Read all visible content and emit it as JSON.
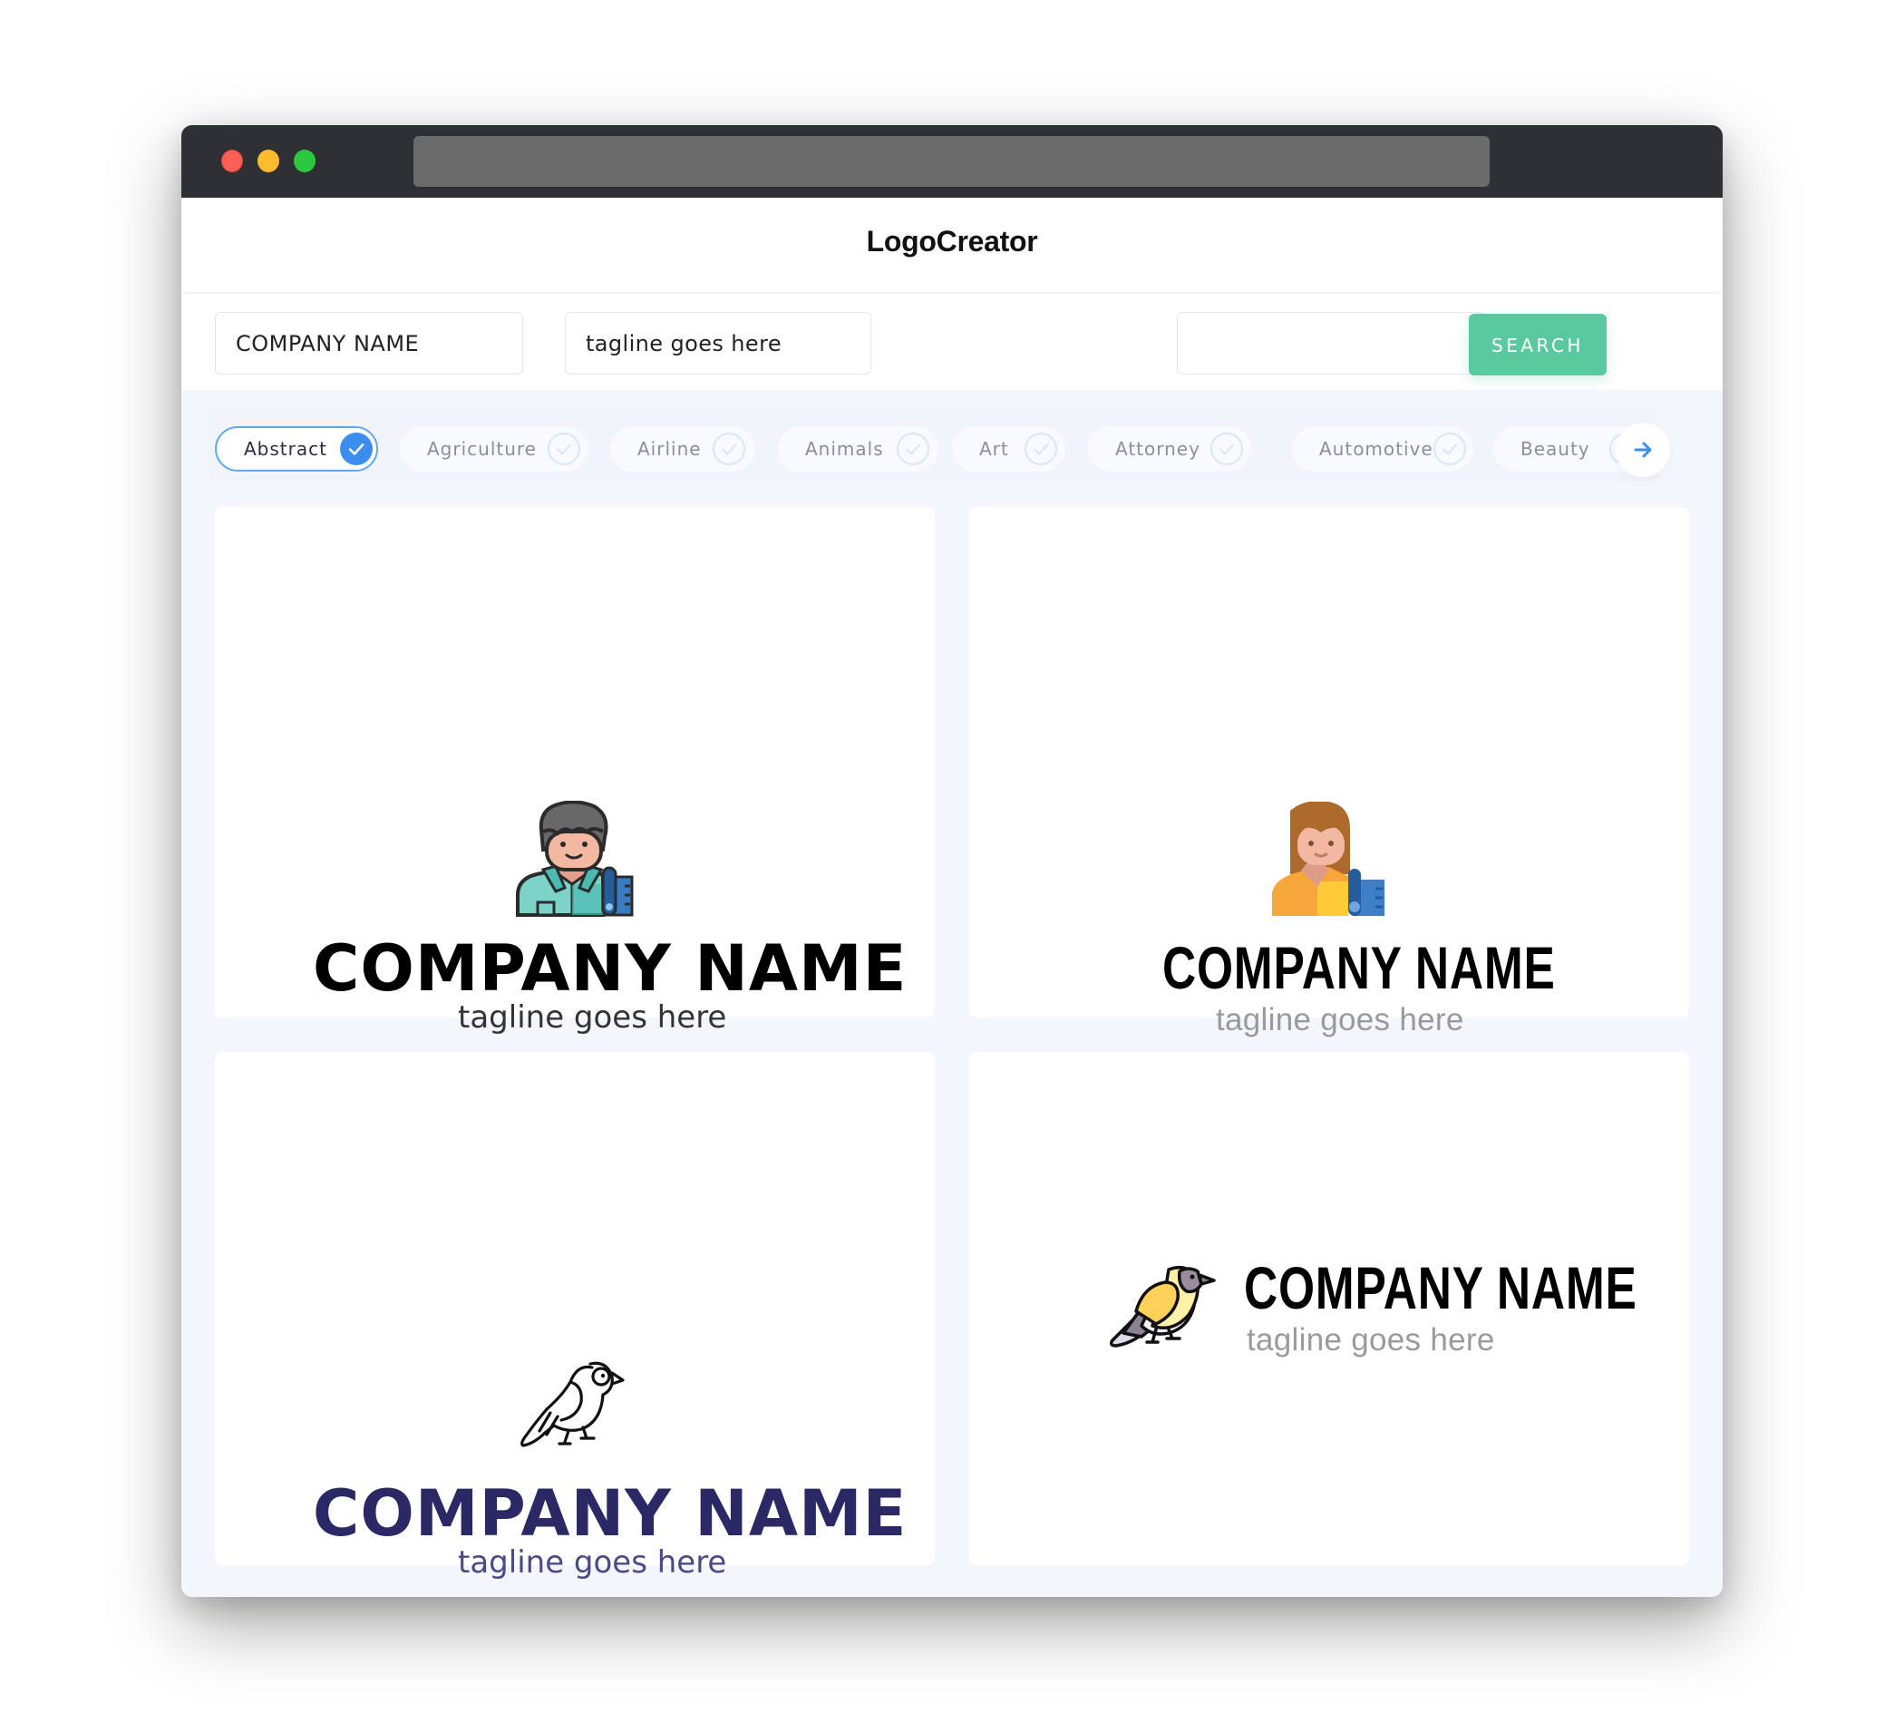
{
  "window": {
    "controls": [
      "close",
      "minimize",
      "maximize"
    ],
    "url": ""
  },
  "header": {
    "brand": "LogoCreator"
  },
  "search": {
    "company_value": "COMPANY NAME",
    "tagline_value": "tagline goes here",
    "extra_value": "",
    "button_label": "SEARCH"
  },
  "categories": {
    "items": [
      {
        "label": "Abstract",
        "selected": true
      },
      {
        "label": "Agriculture",
        "selected": false
      },
      {
        "label": "Airline",
        "selected": false
      },
      {
        "label": "Animals",
        "selected": false
      },
      {
        "label": "Art",
        "selected": false
      },
      {
        "label": "Attorney",
        "selected": false
      },
      {
        "label": "Automotive",
        "selected": false
      },
      {
        "label": "Beauty",
        "selected": false
      }
    ],
    "next_icon": "arrow-right-icon"
  },
  "colors": {
    "accent_green": "#5ac9a0",
    "accent_blue": "#3b8ef0",
    "navy": "#2a2966"
  },
  "logos": [
    {
      "icon": "male-tailor-icon",
      "name": "COMPANY NAME",
      "tagline": "tagline goes here",
      "name_color": "#000000",
      "tagline_color": "#333333"
    },
    {
      "icon": "female-tailor-icon",
      "name": "COMPANY NAME",
      "tagline": "tagline goes here",
      "name_color": "#000000",
      "tagline_color": "#9a9a9a"
    },
    {
      "icon": "bird-outline-icon",
      "name": "COMPANY NAME",
      "tagline": "tagline goes here",
      "name_color": "#2a2966",
      "tagline_color": "#4a4a86"
    },
    {
      "icon": "bird-color-icon",
      "name": "COMPANY NAME",
      "tagline": "tagline goes here",
      "name_color": "#000000",
      "tagline_color": "#9a9a9a"
    }
  ]
}
